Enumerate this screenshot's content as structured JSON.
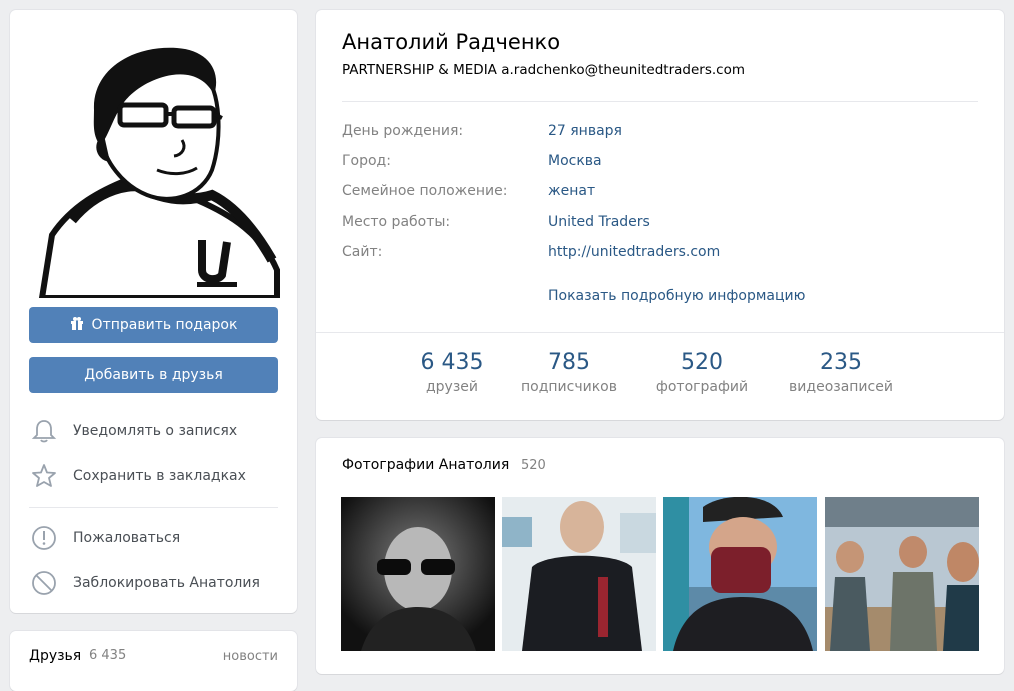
{
  "profile": {
    "name": "Анатолий Радченко",
    "status": "PARTNERSHIP & MEDIA a.radchenko@theunitedtraders.com"
  },
  "left": {
    "gift_button": "Отправить подарок",
    "add_friend_button": "Добавить в друзья",
    "notify": "Уведомлять о записях",
    "bookmark": "Сохранить в закладках",
    "report": "Пожаловаться",
    "block": "Заблокировать Анатолия"
  },
  "info_rows": [
    {
      "label": "День рождения:",
      "value": "27 января"
    },
    {
      "label": "Город:",
      "value": "Москва"
    },
    {
      "label": "Семейное положение:",
      "value": "женат"
    },
    {
      "label": "Место работы:",
      "value": "United Traders"
    },
    {
      "label": "Сайт:",
      "value": "http://unitedtraders.com"
    }
  ],
  "more_info": "Показать подробную информацию",
  "counters": [
    {
      "num": "6 435",
      "cap": "друзей"
    },
    {
      "num": "785",
      "cap": "подписчиков"
    },
    {
      "num": "520",
      "cap": "фотографий"
    },
    {
      "num": "235",
      "cap": "видеозаписей"
    }
  ],
  "photos": {
    "title": "Фотографии Анатолия",
    "count": "520"
  },
  "friends_block": {
    "title": "Друзья",
    "count": "6 435",
    "news": "новости"
  },
  "colors": {
    "accent": "#5181b8",
    "link": "#2a5885",
    "muted": "#828282",
    "background": "#edeef0"
  }
}
